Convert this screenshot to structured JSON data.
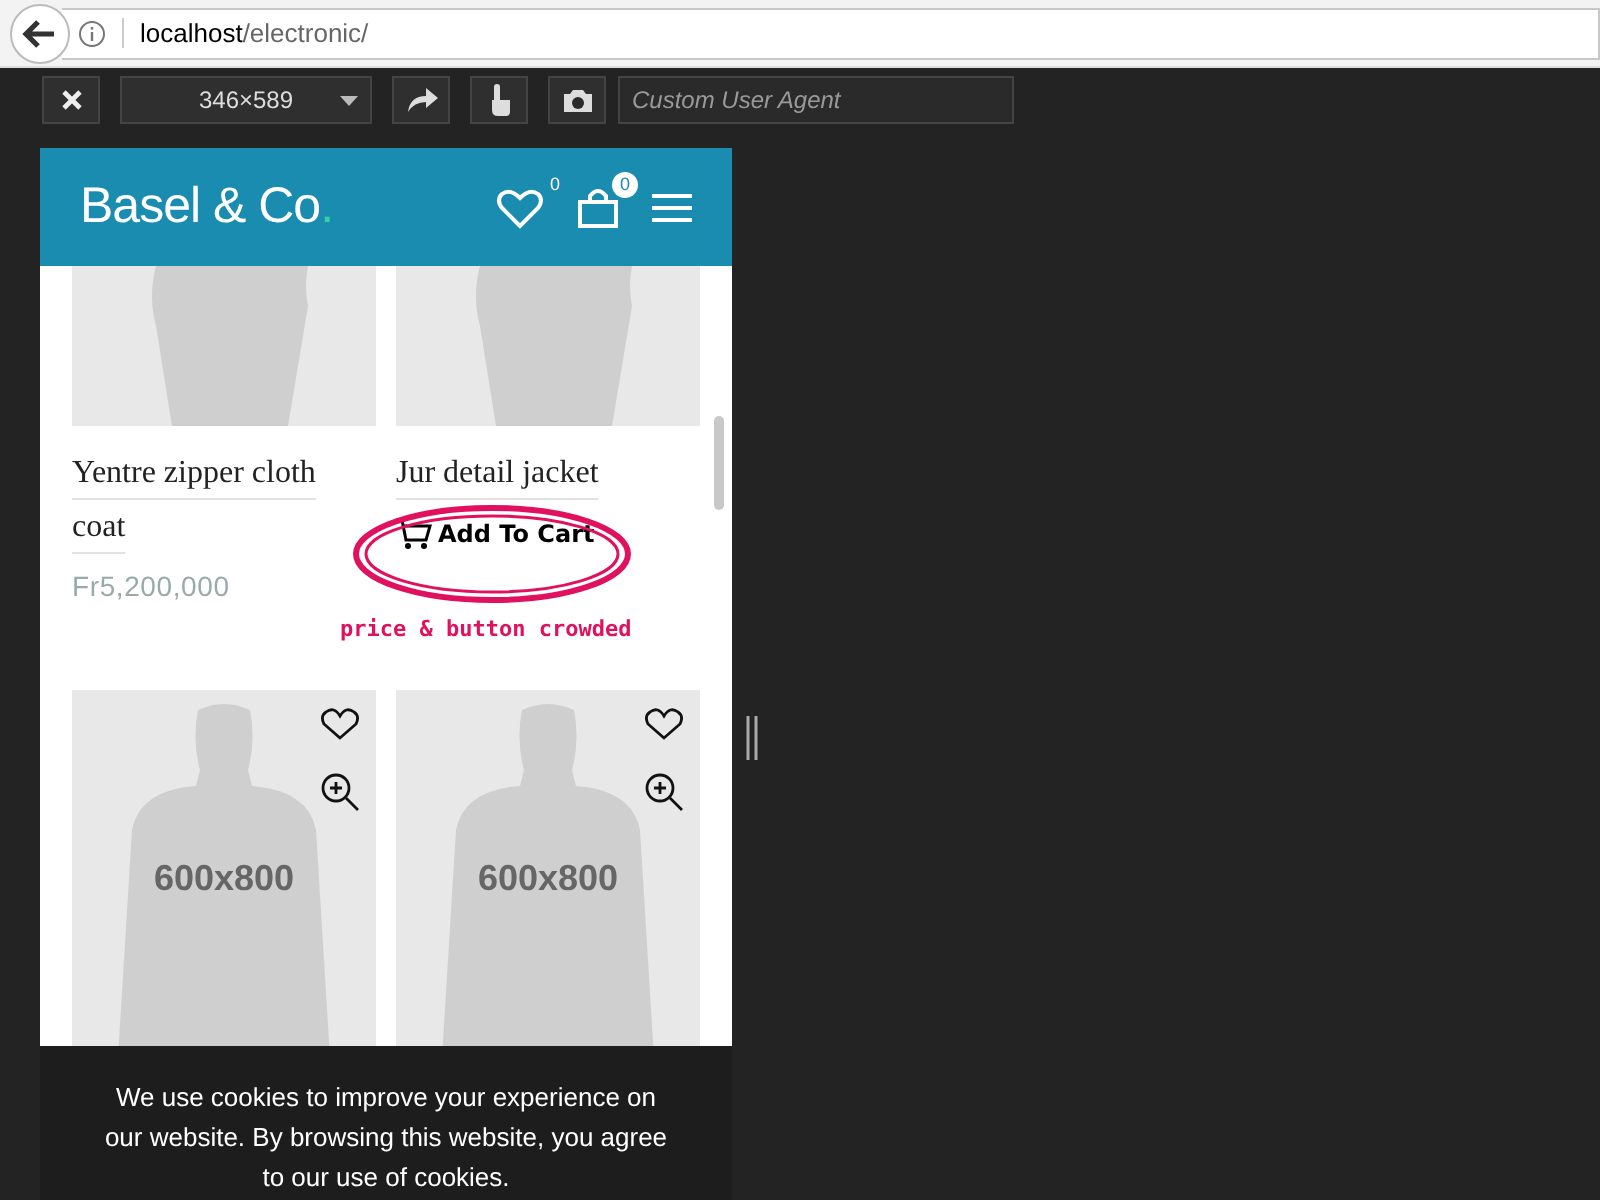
{
  "browser": {
    "url_host": "localhost",
    "url_path": "/electronic/"
  },
  "responsive_toolbar": {
    "size": "346×589",
    "user_agent_placeholder": "Custom User Agent"
  },
  "site_header": {
    "logo": "Basel & Co",
    "logo_dot": ".",
    "wishlist_count": "0",
    "cart_count": "0"
  },
  "products": [
    {
      "kind": "listed",
      "name": "Yentre zipper cloth coat",
      "price": "Fr5,200,000"
    },
    {
      "kind": "listed",
      "name": "Jur detail jacket",
      "cart_button": "Add To Cart"
    },
    {
      "kind": "placeholder",
      "label": "600x800"
    },
    {
      "kind": "placeholder",
      "label": "600x800"
    }
  ],
  "annotation": {
    "note": "price & button crowded"
  },
  "cookie_notice": {
    "text": "We use cookies to improve your experience on our website. By browsing this website, you agree to our use of cookies."
  }
}
